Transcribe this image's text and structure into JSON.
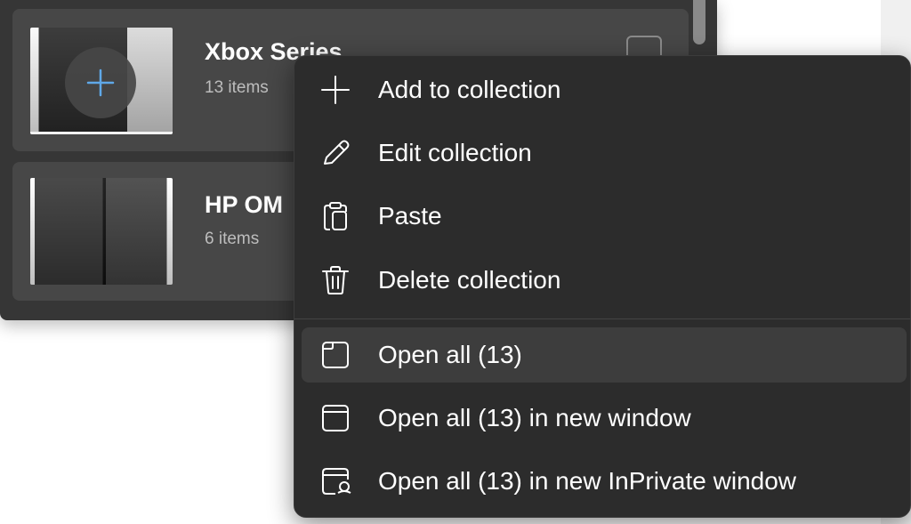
{
  "collections": [
    {
      "title": "Xbox Series",
      "subtitle": "13 items"
    },
    {
      "title": "HP OM",
      "subtitle": "6 items"
    }
  ],
  "context_menu": {
    "items": [
      {
        "label": "Add to collection",
        "icon": "plus-icon"
      },
      {
        "label": "Edit collection",
        "icon": "pencil-icon"
      },
      {
        "label": "Paste",
        "icon": "clipboard-icon"
      },
      {
        "label": "Delete collection",
        "icon": "trash-icon"
      },
      {
        "label": "Open all (13)",
        "icon": "tab-icon",
        "highlighted": true
      },
      {
        "label": "Open all (13) in new window",
        "icon": "window-icon"
      },
      {
        "label": "Open all (13) in new InPrivate window",
        "icon": "inprivate-window-icon"
      }
    ]
  },
  "colors": {
    "menu_bg": "#2c2c2c",
    "panel_bg": "#363636",
    "card_bg": "#474747",
    "hover_bg": "#3d3d3d",
    "accent_plus": "#5fa8e8"
  }
}
